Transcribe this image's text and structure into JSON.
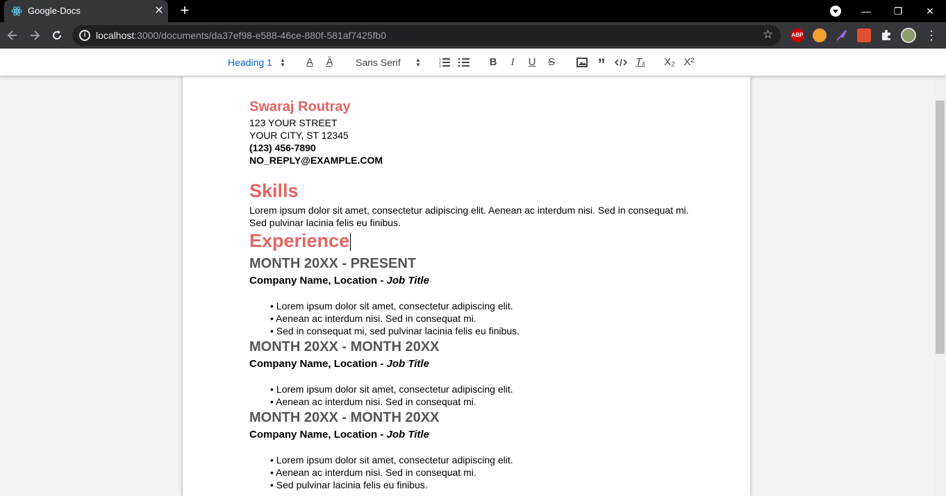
{
  "browser": {
    "tab_title": "Google-Docs",
    "tab_close": "✕",
    "new_tab": "+",
    "url_host": "localhost",
    "url_rest": ":3000/documents/da37ef98-e588-46ce-880f-581af7425fb0",
    "window_minimize": "—",
    "window_restore": "❐",
    "window_close": "✕",
    "extensions": [
      {
        "name": "adblock",
        "label": "ABP",
        "color": "#c00"
      },
      {
        "name": "owl-extension",
        "label": "",
        "color": "#f0a030"
      },
      {
        "name": "feather-extension",
        "label": "",
        "color": "#9a6ad8"
      },
      {
        "name": "tile-extension",
        "label": "",
        "color": "#e05030"
      }
    ]
  },
  "toolbar": {
    "heading_select": "Heading 1",
    "font_select": "Sans Serif",
    "subscript": "X₂",
    "superscript": "X²"
  },
  "document": {
    "name": "Swaraj Routray",
    "address_line1": "123 YOUR STREET",
    "address_line2": "YOUR CITY, ST 12345",
    "phone": "(123) 456-7890",
    "email": "NO_REPLY@EXAMPLE.COM",
    "skills_heading": "Skills",
    "skills_text": "Lorem ipsum dolor sit amet, consectetur adipiscing elit. Aenean ac interdum nisi. Sed in consequat mi. Sed pulvinar lacinia felis eu finibus.",
    "experience_heading": "Experience",
    "jobs": [
      {
        "period": "MONTH 20XX - PRESENT",
        "company": "Company Name, Location - ",
        "title": "Job Title",
        "bullets": [
          "• Lorem ipsum dolor sit amet, consectetur adipiscing elit.",
          "• Aenean ac interdum nisi. Sed in consequat mi.",
          "• Sed in consequat mi, sed pulvinar lacinia felis eu finibus."
        ]
      },
      {
        "period": "MONTH 20XX - MONTH 20XX",
        "company": "Company Name, Location - ",
        "title": "Job Title",
        "bullets": [
          "• Lorem ipsum dolor sit amet, consectetur adipiscing elit.",
          "• Aenean ac interdum nisi. Sed in consequat mi."
        ]
      },
      {
        "period": "MONTH 20XX - MONTH 20XX",
        "company": "Company Name, Location - ",
        "title": "Job Title",
        "bullets": [
          "• Lorem ipsum dolor sit amet, consectetur adipiscing elit.",
          "• Aenean ac interdum nisi. Sed in consequat mi.",
          "• Sed pulvinar lacinia felis eu finibus."
        ]
      }
    ]
  },
  "colors": {
    "heading_accent": "#e46464",
    "toolbar_active": "#0066cc",
    "month_heading": "#555555"
  }
}
